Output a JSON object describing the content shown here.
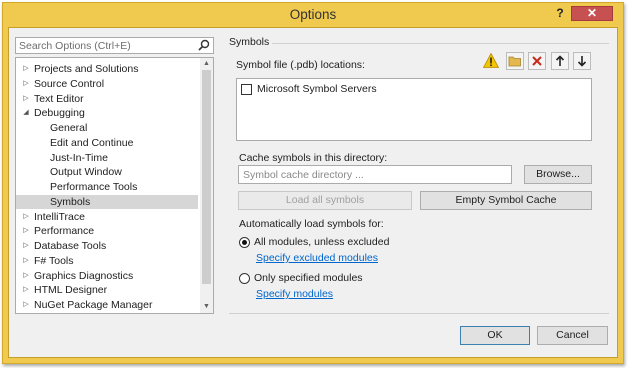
{
  "window": {
    "title": "Options",
    "help_label": "?",
    "close_label": "✕"
  },
  "search": {
    "placeholder": "Search Options (Ctrl+E)"
  },
  "tree": {
    "items": [
      {
        "label": "Projects and Solutions",
        "arrow": "▷"
      },
      {
        "label": "Source Control",
        "arrow": "▷"
      },
      {
        "label": "Text Editor",
        "arrow": "▷"
      },
      {
        "label": "Debugging",
        "arrow": "◢"
      },
      {
        "label": "General",
        "arrow": ""
      },
      {
        "label": "Edit and Continue",
        "arrow": ""
      },
      {
        "label": "Just-In-Time",
        "arrow": ""
      },
      {
        "label": "Output Window",
        "arrow": ""
      },
      {
        "label": "Performance Tools",
        "arrow": ""
      },
      {
        "label": "Symbols",
        "arrow": ""
      },
      {
        "label": "IntelliTrace",
        "arrow": "▷"
      },
      {
        "label": "Performance",
        "arrow": "▷"
      },
      {
        "label": "Database Tools",
        "arrow": "▷"
      },
      {
        "label": "F# Tools",
        "arrow": "▷"
      },
      {
        "label": "Graphics Diagnostics",
        "arrow": "▷"
      },
      {
        "label": "HTML Designer",
        "arrow": "▷"
      },
      {
        "label": "NuGet Package Manager",
        "arrow": "▷"
      }
    ]
  },
  "symbols": {
    "section_title": "Symbols",
    "locations_label": "Symbol file (.pdb) locations:",
    "server_item": "Microsoft Symbol Servers",
    "cache_label": "Cache symbols in this directory:",
    "cache_placeholder": "Symbol cache directory ...",
    "browse_label": "Browse...",
    "load_all_label": "Load all symbols",
    "empty_cache_label": "Empty Symbol Cache",
    "auto_load_label": "Automatically load symbols for:",
    "option_all": "All modules, unless excluded",
    "link_excluded": "Specify excluded modules",
    "option_specified": "Only specified modules",
    "link_modules": "Specify modules"
  },
  "footer": {
    "ok_label": "OK",
    "cancel_label": "Cancel"
  }
}
